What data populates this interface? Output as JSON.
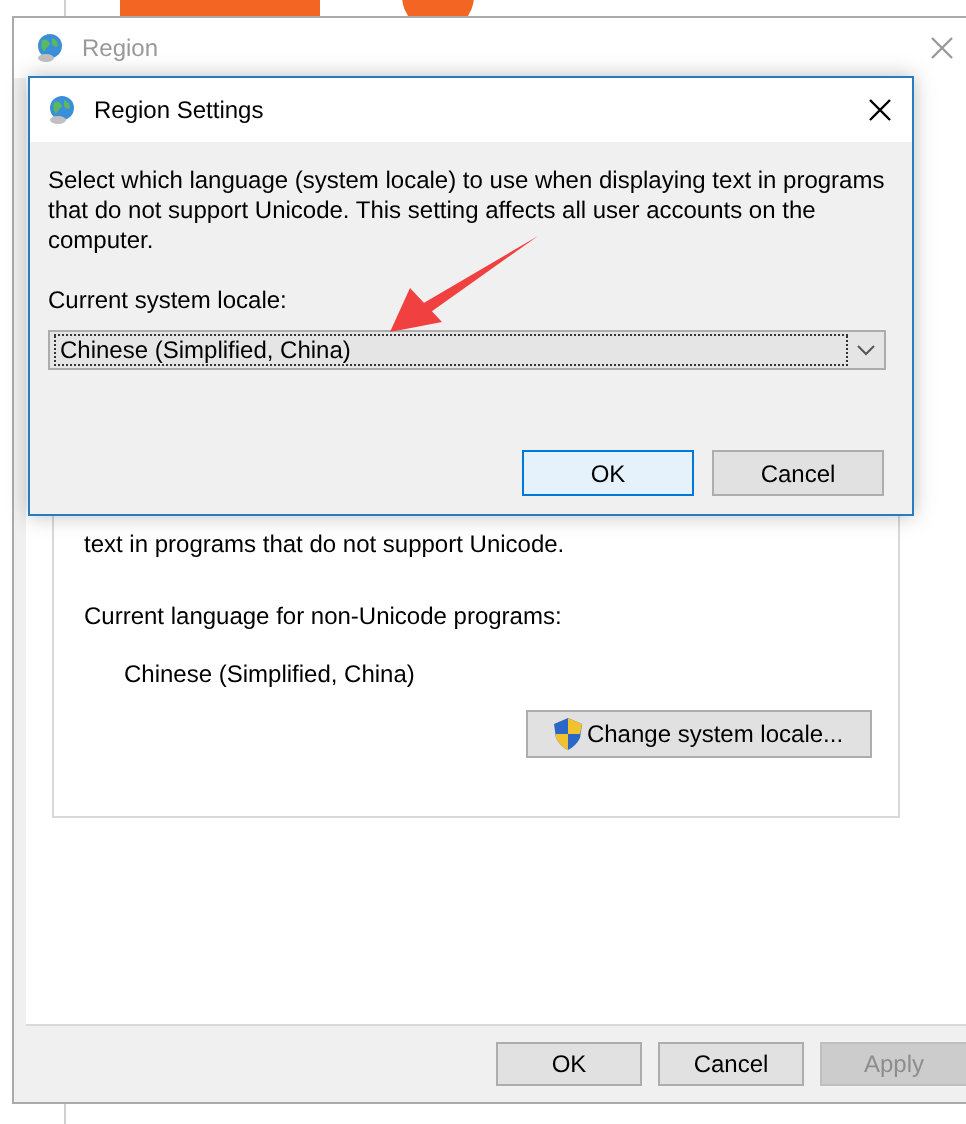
{
  "region_window": {
    "title": "Region",
    "note": "text in programs that do not support Unicode.",
    "current_language_label": "Current language for non-Unicode programs:",
    "current_language": "Chinese (Simplified, China)",
    "change_button": "Change system locale...",
    "buttons": [
      {
        "label": "OK",
        "disabled": false
      },
      {
        "label": "Cancel",
        "disabled": false
      },
      {
        "label": "Apply",
        "disabled": true
      }
    ]
  },
  "dialog": {
    "title": "Region Settings",
    "description": "Select which language (system locale) to use when displaying text in programs that do not support Unicode. This setting affects all user accounts on the computer.",
    "locale_label": "Current system locale:",
    "locale_value": "Chinese (Simplified, China)",
    "buttons": [
      {
        "label": "OK",
        "default": true
      },
      {
        "label": "Cancel",
        "default": false
      }
    ]
  }
}
